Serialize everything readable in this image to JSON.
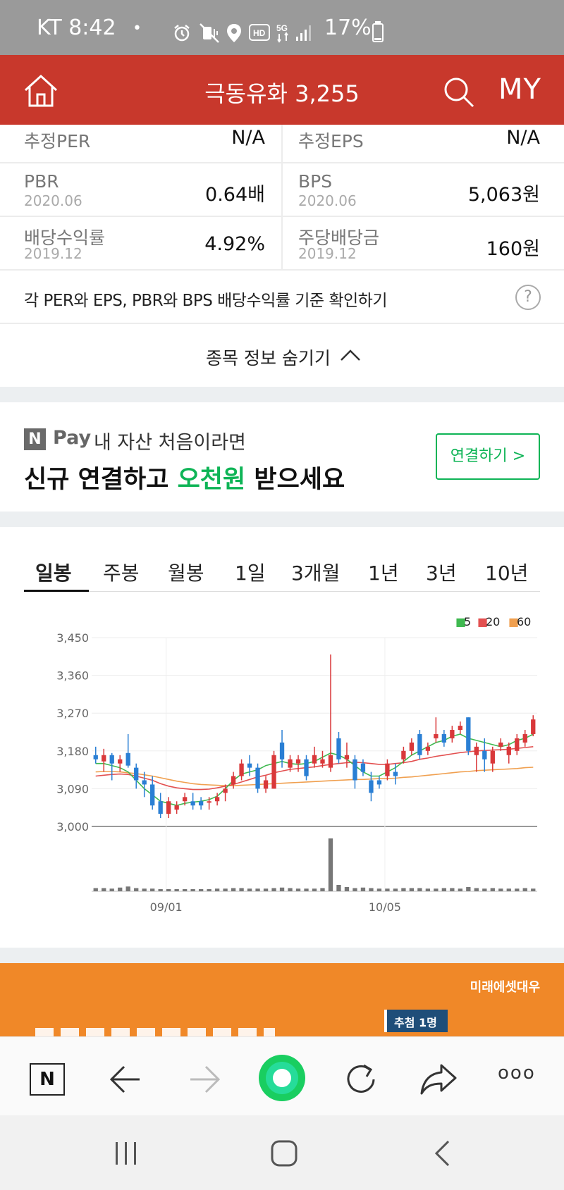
{
  "status_bar": {
    "carrier_time": "KT 8:42",
    "dot": "•",
    "battery_pct": "17%",
    "icons": [
      "alarm-icon",
      "mute-vibrate-icon",
      "location-icon",
      "hd-icon",
      "5g-icon",
      "signal-icon",
      "battery-icon"
    ]
  },
  "header": {
    "title": "극동유화 3,255",
    "my_label": "MY"
  },
  "info_table": {
    "rows": [
      {
        "left": {
          "label": "추정PER",
          "sub": "",
          "value": "N/A"
        },
        "right": {
          "label": "추정EPS",
          "sub": "",
          "value": "N/A"
        }
      },
      {
        "left": {
          "label": "PBR",
          "sub": "2020.06",
          "value": "0.64배"
        },
        "right": {
          "label": "BPS",
          "sub": "2020.06",
          "value": "5,063원"
        }
      },
      {
        "left": {
          "label": "배당수익률",
          "sub": "2019.12",
          "value": "4.92%"
        },
        "right": {
          "label": "주당배당금",
          "sub": "2019.12",
          "value": "160원"
        }
      }
    ],
    "help_text": "각 PER와 EPS, PBR와 BPS 배당수익률 기준 확인하기",
    "help_icon_text": "?",
    "hide_info": "종목 정보 숨기기"
  },
  "ad": {
    "badge": "N",
    "pay_word": "Pay",
    "line1": "내 자산 처음이라면",
    "line2_a": "신규 연결하고 ",
    "line2_b": "오천원",
    "line2_c": " 받으세요",
    "button": "연결하기 >",
    "accent_green": "#0eb456"
  },
  "chart_tabs": {
    "items": [
      "일봉",
      "주봉",
      "월봉",
      "1일",
      "3개월",
      "1년",
      "3년",
      "10년"
    ],
    "active": "일봉"
  },
  "chart_data": {
    "type": "candlestick",
    "legend": [
      {
        "label": "5",
        "color": "#3fb950"
      },
      {
        "label": "20",
        "color": "#e35050"
      },
      {
        "label": "60",
        "color": "#f0a050"
      }
    ],
    "y_ticks": [
      "3,450",
      "3,360",
      "3,270",
      "3,180",
      "3,090",
      "3,000"
    ],
    "ylim": [
      3000,
      3450
    ],
    "x_ticks": [
      "09/01",
      "10/05"
    ],
    "up_color": "#d9383a",
    "down_color": "#2a7fd4",
    "candles": [
      [
        3170,
        3190,
        3150,
        3160
      ],
      [
        3155,
        3185,
        3130,
        3170
      ],
      [
        3170,
        3175,
        3110,
        3150
      ],
      [
        3150,
        3170,
        3130,
        3160
      ],
      [
        3175,
        3220,
        3140,
        3145
      ],
      [
        3140,
        3150,
        3090,
        3110
      ],
      [
        3110,
        3130,
        3070,
        3100
      ],
      [
        3100,
        3120,
        3040,
        3050
      ],
      [
        3060,
        3080,
        3020,
        3030
      ],
      [
        3030,
        3070,
        3020,
        3060
      ],
      [
        3040,
        3060,
        3030,
        3050
      ],
      [
        3060,
        3080,
        3050,
        3070
      ],
      [
        3060,
        3080,
        3040,
        3050
      ],
      [
        3060,
        3070,
        3040,
        3050
      ],
      [
        3060,
        3070,
        3040,
        3060
      ],
      [
        3060,
        3080,
        3050,
        3070
      ],
      [
        3080,
        3100,
        3060,
        3090
      ],
      [
        3100,
        3130,
        3090,
        3120
      ],
      [
        3120,
        3160,
        3110,
        3150
      ],
      [
        3150,
        3170,
        3120,
        3140
      ],
      [
        3140,
        3150,
        3080,
        3090
      ],
      [
        3090,
        3120,
        3080,
        3110
      ],
      [
        3090,
        3180,
        3090,
        3170
      ],
      [
        3200,
        3230,
        3140,
        3160
      ],
      [
        3140,
        3170,
        3130,
        3160
      ],
      [
        3150,
        3170,
        3130,
        3160
      ],
      [
        3160,
        3170,
        3110,
        3120
      ],
      [
        3150,
        3190,
        3140,
        3170
      ],
      [
        3150,
        3180,
        3140,
        3160
      ],
      [
        3140,
        3410,
        3130,
        3170
      ],
      [
        3210,
        3225,
        3150,
        3160
      ],
      [
        3160,
        3200,
        3140,
        3170
      ],
      [
        3160,
        3170,
        3090,
        3110
      ],
      [
        3150,
        3160,
        3120,
        3130
      ],
      [
        3110,
        3130,
        3060,
        3080
      ],
      [
        3110,
        3120,
        3090,
        3100
      ],
      [
        3120,
        3160,
        3110,
        3150
      ],
      [
        3130,
        3150,
        3100,
        3120
      ],
      [
        3160,
        3190,
        3150,
        3180
      ],
      [
        3180,
        3210,
        3170,
        3200
      ],
      [
        3220,
        3230,
        3160,
        3170
      ],
      [
        3180,
        3200,
        3170,
        3190
      ],
      [
        3210,
        3260,
        3200,
        3220
      ],
      [
        3220,
        3230,
        3190,
        3200
      ],
      [
        3210,
        3240,
        3200,
        3230
      ],
      [
        3230,
        3250,
        3220,
        3240
      ],
      [
        3260,
        3260,
        3170,
        3180
      ],
      [
        3170,
        3200,
        3130,
        3190
      ],
      [
        3180,
        3210,
        3130,
        3160
      ],
      [
        3150,
        3190,
        3130,
        3180
      ],
      [
        3190,
        3210,
        3180,
        3200
      ],
      [
        3170,
        3200,
        3150,
        3190
      ],
      [
        3180,
        3220,
        3170,
        3210
      ],
      [
        3200,
        3230,
        3190,
        3220
      ],
      [
        3220,
        3265,
        3215,
        3255
      ]
    ],
    "ma5": [
      3150,
      3150,
      3145,
      3140,
      3130,
      3110,
      3090,
      3075,
      3060,
      3055,
      3050,
      3055,
      3058,
      3060,
      3064,
      3072,
      3090,
      3110,
      3125,
      3130,
      3135,
      3145,
      3150,
      3155,
      3150,
      3148,
      3150,
      3155,
      3165,
      3175,
      3170,
      3160,
      3145,
      3130,
      3120,
      3120,
      3130,
      3140,
      3155,
      3170,
      3180,
      3190,
      3200,
      3205,
      3215,
      3220,
      3210,
      3205,
      3200,
      3195,
      3190,
      3195,
      3205,
      3210,
      3220
    ],
    "ma20": [
      3120,
      3122,
      3124,
      3125,
      3124,
      3120,
      3115,
      3110,
      3102,
      3096,
      3092,
      3090,
      3088,
      3088,
      3089,
      3092,
      3096,
      3100,
      3106,
      3112,
      3118,
      3122,
      3128,
      3132,
      3136,
      3138,
      3140,
      3142,
      3145,
      3148,
      3150,
      3152,
      3153,
      3152,
      3150,
      3148,
      3148,
      3150,
      3152,
      3155,
      3160,
      3163,
      3167,
      3170,
      3173,
      3176,
      3178,
      3180,
      3181,
      3182,
      3183,
      3184,
      3186,
      3188,
      3190
    ],
    "ma60": [
      3130,
      3131,
      3131,
      3130,
      3128,
      3126,
      3123,
      3120,
      3116,
      3112,
      3108,
      3105,
      3102,
      3100,
      3099,
      3098,
      3097,
      3097,
      3098,
      3099,
      3100,
      3101,
      3102,
      3103,
      3104,
      3105,
      3106,
      3107,
      3108,
      3109,
      3110,
      3111,
      3112,
      3112,
      3113,
      3114,
      3114,
      3115,
      3117,
      3118,
      3120,
      3122,
      3124,
      3126,
      3128,
      3130,
      3131,
      3133,
      3134,
      3135,
      3136,
      3137,
      3138,
      3140,
      3141
    ],
    "volume": [
      6,
      6,
      5,
      7,
      9,
      6,
      5,
      5,
      4,
      4,
      4,
      4,
      4,
      4,
      4,
      5,
      5,
      6,
      6,
      5,
      5,
      5,
      6,
      7,
      6,
      5,
      5,
      5,
      6,
      100,
      12,
      8,
      6,
      7,
      6,
      5,
      5,
      5,
      6,
      6,
      6,
      5,
      5,
      6,
      6,
      5,
      8,
      6,
      5,
      6,
      5,
      5,
      5,
      6,
      5
    ],
    "volume_max": 100
  },
  "banner": {
    "brand": "미래에셋대우",
    "tag": "추첨 1명",
    "background": "#f08828"
  },
  "toolbar": {
    "naver_label": "N",
    "more_label": "ooo"
  }
}
